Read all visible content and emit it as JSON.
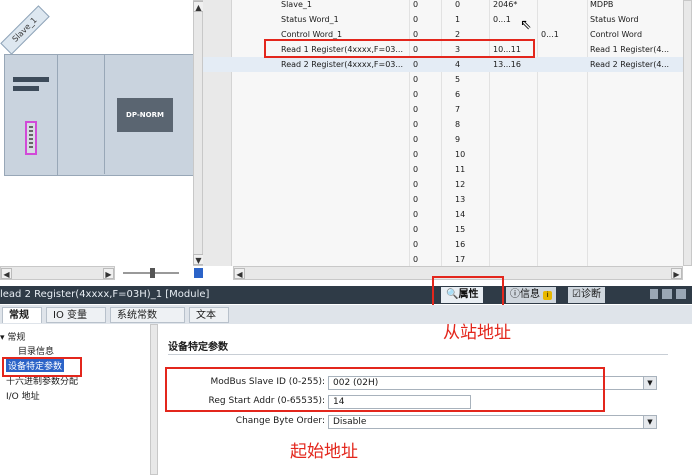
{
  "device": {
    "slave_label": "Slave_1",
    "module_label": "DP-NORM"
  },
  "table": {
    "rows": [
      {
        "name": "Slave_1",
        "c1": "0",
        "c2": "0",
        "c3": "2046*",
        "c4": "",
        "c5": "MDPB"
      },
      {
        "name": "Status Word_1",
        "c1": "0",
        "c2": "1",
        "c3": "0...1",
        "c4": "",
        "c5": "Status Word"
      },
      {
        "name": "Control Word_1",
        "c1": "0",
        "c2": "2",
        "c3": "",
        "c4": "0...1",
        "c5": "Control Word"
      },
      {
        "name": "Read 1 Register(4xxxx,F=03...",
        "c1": "0",
        "c2": "3",
        "c3": "10...11",
        "c4": "",
        "c5": "Read 1 Register(4..."
      },
      {
        "name": "Read 2 Register(4xxxx,F=03...",
        "c1": "0",
        "c2": "4",
        "c3": "13...16",
        "c4": "",
        "c5": "Read 2 Register(4..."
      },
      {
        "name": "",
        "c1": "0",
        "c2": "5",
        "c3": "",
        "c4": "",
        "c5": ""
      },
      {
        "name": "",
        "c1": "0",
        "c2": "6",
        "c3": "",
        "c4": "",
        "c5": ""
      },
      {
        "name": "",
        "c1": "0",
        "c2": "7",
        "c3": "",
        "c4": "",
        "c5": ""
      },
      {
        "name": "",
        "c1": "0",
        "c2": "8",
        "c3": "",
        "c4": "",
        "c5": ""
      },
      {
        "name": "",
        "c1": "0",
        "c2": "9",
        "c3": "",
        "c4": "",
        "c5": ""
      },
      {
        "name": "",
        "c1": "0",
        "c2": "10",
        "c3": "",
        "c4": "",
        "c5": ""
      },
      {
        "name": "",
        "c1": "0",
        "c2": "11",
        "c3": "",
        "c4": "",
        "c5": ""
      },
      {
        "name": "",
        "c1": "0",
        "c2": "12",
        "c3": "",
        "c4": "",
        "c5": ""
      },
      {
        "name": "",
        "c1": "0",
        "c2": "13",
        "c3": "",
        "c4": "",
        "c5": ""
      },
      {
        "name": "",
        "c1": "0",
        "c2": "14",
        "c3": "",
        "c4": "",
        "c5": ""
      },
      {
        "name": "",
        "c1": "0",
        "c2": "15",
        "c3": "",
        "c4": "",
        "c5": ""
      },
      {
        "name": "",
        "c1": "0",
        "c2": "16",
        "c3": "",
        "c4": "",
        "c5": ""
      },
      {
        "name": "",
        "c1": "0",
        "c2": "17",
        "c3": "",
        "c4": "",
        "c5": ""
      }
    ]
  },
  "module_title": "lead 2 Register(4xxxx,F=03H)_1 [Module]",
  "inspector": {
    "properties_label": "属性",
    "info_label": "信息",
    "diagnostics_label": "诊断"
  },
  "tabs": [
    "常规",
    "IO 变量",
    "系统常数",
    "文本"
  ],
  "nav": {
    "general": "常规",
    "catalog": "目录信息",
    "device_params": "设备特定参数",
    "hex_params": "十六进制参数分配",
    "io_address": "I/O 地址"
  },
  "section_title": "设备特定参数",
  "params": {
    "slave_id_label": "ModBus Slave ID (0-255):",
    "slave_id_value": "002 (02H)",
    "start_addr_label": "Reg Start Addr (0-65535):",
    "start_addr_value": "14",
    "byte_order_label": "Change Byte Order:",
    "byte_order_value": "Disable"
  },
  "annotations": {
    "slave_address": "从站地址",
    "start_address": "起始地址"
  },
  "colors": {
    "annotation": "#e3261c",
    "title_bar": "#2f3b47",
    "selection": "#2b63c8",
    "highlight_port": "#d14ad8"
  }
}
